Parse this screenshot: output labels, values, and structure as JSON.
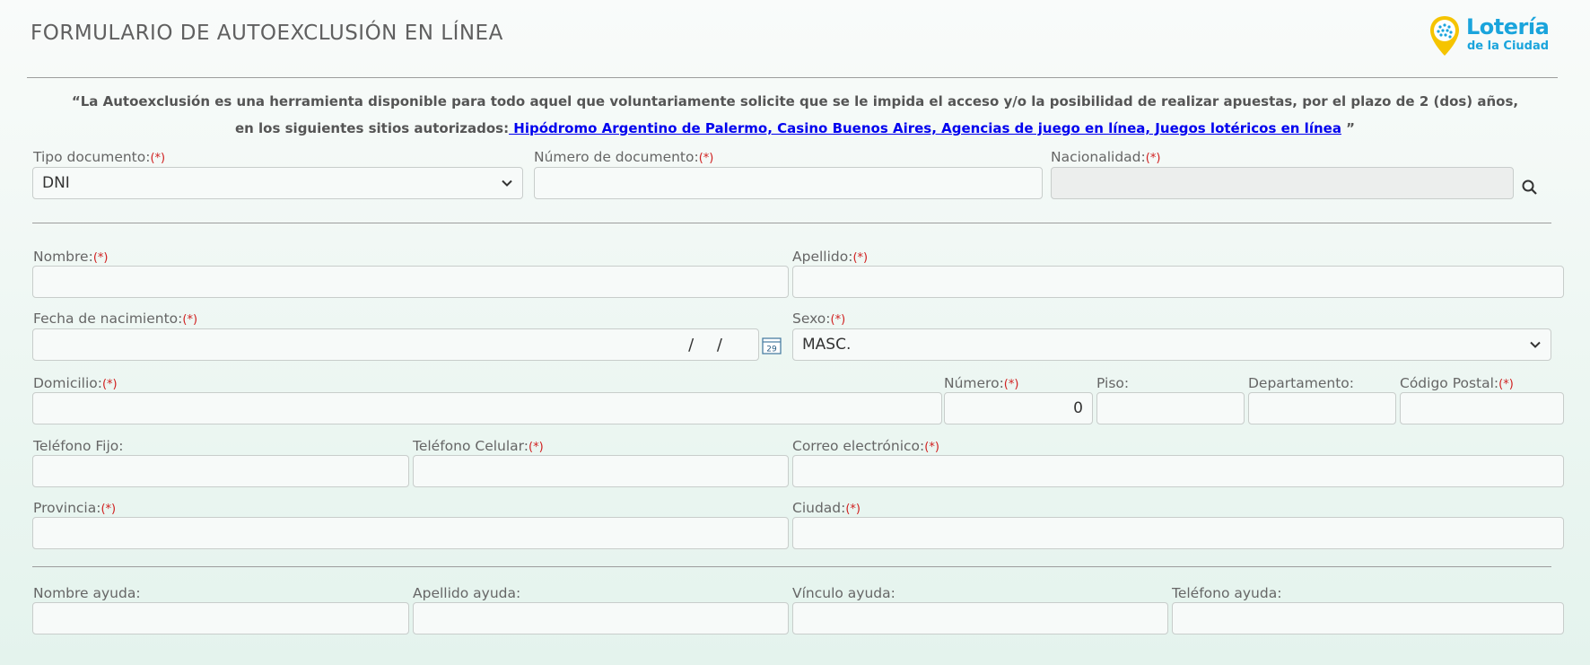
{
  "header": {
    "title": "FORMULARIO DE AUTOEXCLUSIÓN EN LÍNEA",
    "logo_line1": "Lotería",
    "logo_line2": "de la Ciudad"
  },
  "intro": {
    "line1": "“La Autoexclusión es una herramienta disponible para todo aquel que voluntariamente solicite que se le impida el acceso y/o la posibilidad de realizar apuestas, por el plazo de 2 (dos) años,",
    "line2_prefix": "en los siguientes sitios autorizados:",
    "line2_link": " Hipódromo Argentino de Palermo, Casino Buenos Aires, Agencias de juego en línea, Juegos lotéricos en línea",
    "line2_suffix": " ”"
  },
  "required_mark": "(*)",
  "form": {
    "tipo_documento": {
      "label": "Tipo documento:",
      "value": "DNI"
    },
    "numero_documento": {
      "label": "Número de documento:",
      "value": ""
    },
    "nacionalidad": {
      "label": "Nacionalidad:",
      "value": ""
    },
    "nombre": {
      "label": "Nombre:",
      "value": ""
    },
    "apellido": {
      "label": "Apellido:",
      "value": ""
    },
    "fecha_nacimiento": {
      "label": "Fecha de nacimiento:",
      "value": "/ /",
      "calendar_day": "29"
    },
    "sexo": {
      "label": "Sexo:",
      "value": "MASC."
    },
    "domicilio": {
      "label": "Domicilio:",
      "value": ""
    },
    "numero": {
      "label": "Número:",
      "value": "0"
    },
    "piso": {
      "label": "Piso:",
      "value": ""
    },
    "departamento": {
      "label": "Departamento:",
      "value": ""
    },
    "codigo_postal": {
      "label": "Código Postal:",
      "value": ""
    },
    "telefono_fijo": {
      "label": "Teléfono Fijo:",
      "value": ""
    },
    "telefono_celular": {
      "label": "Teléfono Celular:",
      "value": ""
    },
    "correo": {
      "label": "Correo electrónico:",
      "value": ""
    },
    "provincia": {
      "label": "Provincia:",
      "value": ""
    },
    "ciudad": {
      "label": "Ciudad:",
      "value": ""
    },
    "nombre_ayuda": {
      "label": "Nombre ayuda:",
      "value": ""
    },
    "apellido_ayuda": {
      "label": "Apellido ayuda:",
      "value": ""
    },
    "vinculo_ayuda": {
      "label": "Vínculo ayuda:",
      "value": ""
    },
    "telefono_ayuda": {
      "label": "Teléfono ayuda:",
      "value": ""
    }
  },
  "icons": {
    "search": "search-icon",
    "calendar": "calendar-icon",
    "dropdown": "chevron-down-icon"
  },
  "colors": {
    "link": "#0000ee",
    "required": "#d02020",
    "logo": "#1aa4dc",
    "logo_pin": "#f5c400"
  }
}
